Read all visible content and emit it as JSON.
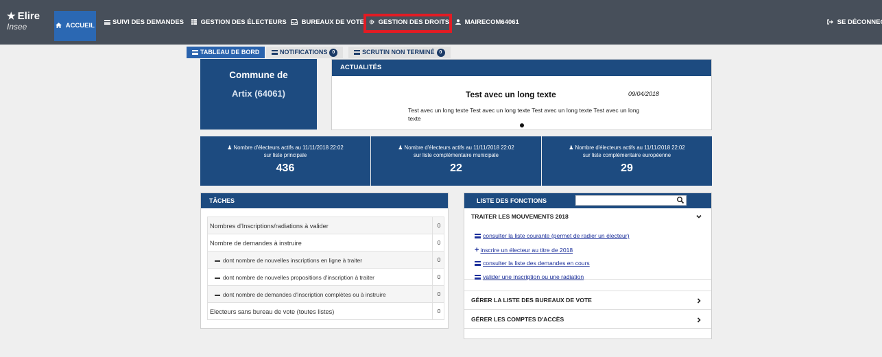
{
  "brand": {
    "title": "Elire",
    "subtitle": "Insee"
  },
  "nav": {
    "home": "ACCUEIL",
    "suivi": "SUIVI DES DEMANDES",
    "gestion_electeurs": "GESTION DES ÉLECTEURS",
    "bureaux": "BUREAUX DE VOTE",
    "gestion_droits": "GESTION DES DROITS",
    "user": "MAIRECOM64061",
    "logout": "SE DÉCONNECTER"
  },
  "tabs": [
    {
      "label": "TABLEAU DE BORD"
    },
    {
      "label": "NOTIFICATIONS",
      "badge": "0"
    },
    {
      "label": "SCRUTIN NON TERMINÉ",
      "badge": "0"
    }
  ],
  "commune": {
    "line1": "Commune de",
    "line2": "Artix (64061)"
  },
  "actualites": {
    "header": "ACTUALITÉS",
    "title": "Test avec un long texte",
    "date": "09/04/2018",
    "text": "Test avec un long texte Test avec un long texte Test avec un long texte Test avec un long texte"
  },
  "stats": [
    {
      "line1": "Nombre d'électeurs actifs au 11/11/2018 22:02",
      "line2": "sur liste principale",
      "value": "436"
    },
    {
      "line1": "Nombre d'électeurs actifs au 11/11/2018 22:02",
      "line2": "sur liste complémentaire municipale",
      "value": "22"
    },
    {
      "line1": "Nombre d'électeurs actifs au 11/11/2018 22:02",
      "line2": "sur liste complémentaire européenne",
      "value": "29"
    }
  ],
  "taches": {
    "header": "TÂCHES",
    "rows": [
      {
        "label": "Nombres d'Inscriptions/radiations à valider",
        "value": "0"
      },
      {
        "label": "Nombre de demandes à instruire",
        "value": "0"
      },
      {
        "label": "dont nombre de nouvelles inscriptions en ligne à traiter",
        "value": "0"
      },
      {
        "label": "dont nombre de nouvelles propositions d'inscription à traiter",
        "value": "0"
      },
      {
        "label": "dont nombre de demandes d'inscription complètes ou à instruire",
        "value": "0"
      },
      {
        "label": "Electeurs sans bureau de vote (toutes listes)",
        "value": "0"
      }
    ]
  },
  "fonctions": {
    "header": "LISTE DES FONCTIONS",
    "search_value": "",
    "sections": [
      {
        "title": "TRAITER LES MOUVEMENTS 2018"
      },
      {
        "title": "GÉRER LA LISTE DES BUREAUX DE VOTE"
      },
      {
        "title": "GÉRER LES COMPTES D'ACCÈS"
      }
    ],
    "links": [
      "consulter la liste courante (permet de radier un électeur)",
      "inscrire un électeur au titre de 2018",
      "consulter la liste des demandes en cours",
      "valider une inscription ou une radiation"
    ]
  },
  "colors": {
    "navbar": "#474f5a",
    "primary": "#1d4b80",
    "active": "#2b68b3",
    "highlight": "#e31b23",
    "link": "#1a2e9a"
  }
}
